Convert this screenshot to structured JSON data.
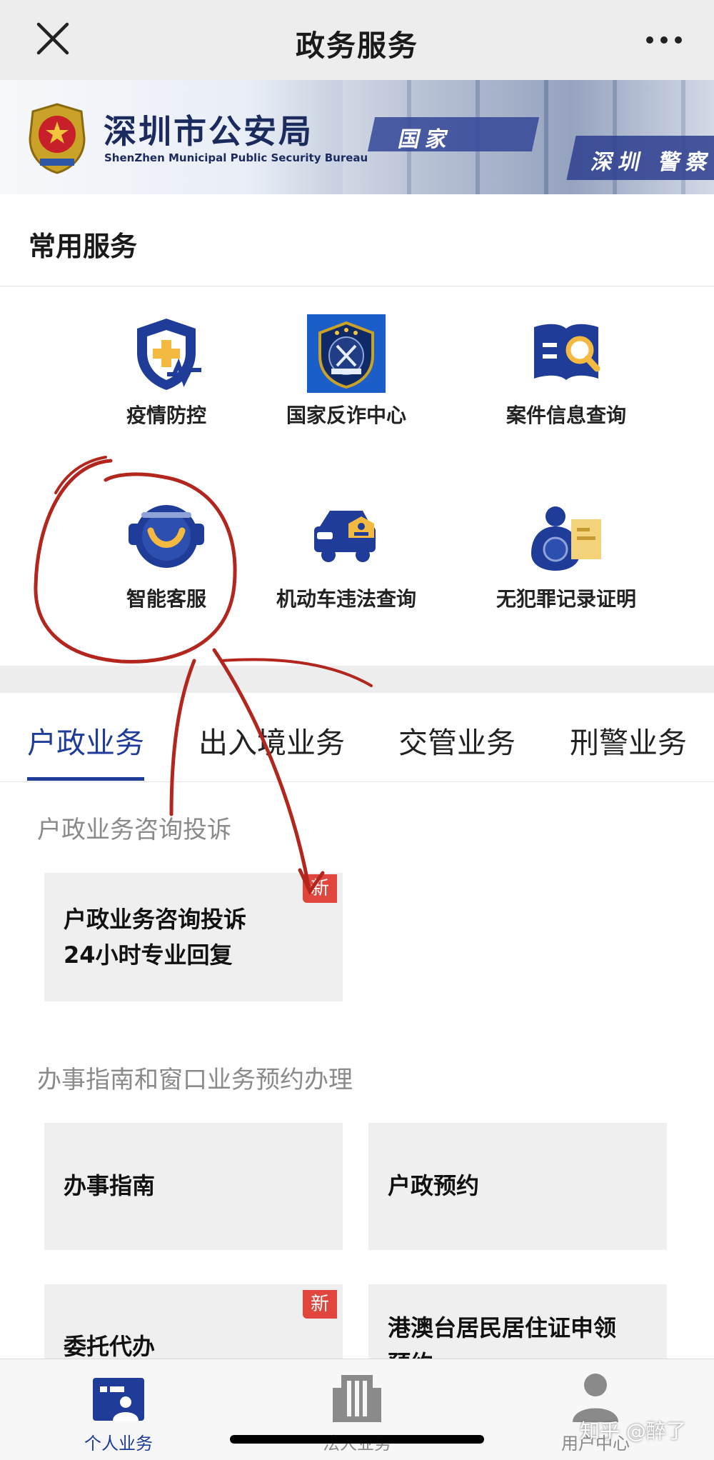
{
  "nav": {
    "title": "政务服务"
  },
  "banner": {
    "org_name": "深圳市公安局",
    "org_en": "ShenZhen Municipal Public Security Bureau",
    "stripe_left": "国家",
    "stripe_right": "深圳 警察"
  },
  "common": {
    "heading": "常用服务",
    "services": [
      {
        "label": "疫情防控",
        "icon": "shield-medical-icon"
      },
      {
        "label": "国家反诈中心",
        "icon": "anti-fraud-badge-icon"
      },
      {
        "label": "案件信息查询",
        "icon": "book-search-icon"
      },
      {
        "label": "智能客服",
        "icon": "chatbot-face-icon"
      },
      {
        "label": "机动车违法查询",
        "icon": "police-car-icon"
      },
      {
        "label": "无犯罪记录证明",
        "icon": "police-certificate-icon"
      }
    ],
    "service_icon_text": "国家反诈中心"
  },
  "tabs": [
    "户政业务",
    "出入境业务",
    "交管业务",
    "刑警业务"
  ],
  "sections": [
    {
      "title": "户政业务咨询投诉",
      "cards": [
        {
          "line1": "户政业务咨询投诉",
          "line2": "24小时专业回复",
          "badge": "新"
        }
      ]
    },
    {
      "title": "办事指南和窗口业务预约办理",
      "cards": [
        {
          "line1": "办事指南"
        },
        {
          "line1": "户政预约"
        },
        {
          "line1": "委托代办",
          "badge": "新"
        },
        {
          "line1": "港澳台居民居住证申领",
          "line2": "预约"
        }
      ]
    }
  ],
  "bottom_tabs": [
    {
      "label": "个人业务",
      "icon": "id-card-icon",
      "active": true
    },
    {
      "label": "法人业务",
      "icon": "building-icon",
      "active": false
    },
    {
      "label": "用户中心",
      "icon": "user-icon",
      "active": false
    }
  ],
  "watermark": "知乎 @醉了",
  "colors": {
    "accent": "#1f3c98",
    "badge": "#e0463d",
    "annotation": "#b3261e"
  }
}
